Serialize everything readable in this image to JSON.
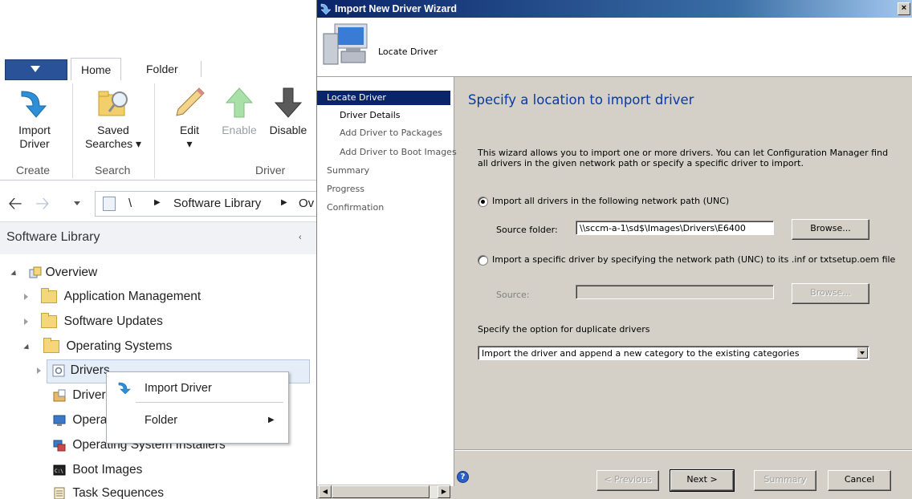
{
  "console": {
    "ribbon_tabs": [
      {
        "label": "Home"
      },
      {
        "label": "Folder"
      }
    ],
    "ribbon_buttons": {
      "import_driver": "Import\nDriver",
      "saved_searches": "Saved\nSearches ▾",
      "edit": "Edit\n▾",
      "enable": "Enable",
      "disable": "Disable"
    },
    "groups": {
      "create": "Create",
      "search": "Search",
      "driver": "Driver"
    },
    "address": {
      "sep": "\\",
      "crumb1": "Software Library",
      "crumb2": "Ov"
    },
    "panel_title": "Software Library",
    "tree": {
      "overview": "Overview",
      "application_management": "Application Management",
      "software_updates": "Software Updates",
      "operating_systems": "Operating Systems",
      "drivers": "Drivers",
      "driver_packages": "Driver",
      "os_images": "Opera",
      "os_installers": "Operating System Installers",
      "boot_images": "Boot Images",
      "task_sequences": "Task Sequences"
    },
    "context_menu": {
      "import_driver": "Import Driver",
      "folder": "Folder"
    }
  },
  "wizard": {
    "title": "Import New Driver Wizard",
    "header_title": "Locate Driver",
    "nav": [
      {
        "label": "Locate Driver"
      },
      {
        "label": "Driver Details"
      },
      {
        "label": "Add Driver to Packages"
      },
      {
        "label": "Add Driver to Boot Images"
      },
      {
        "label": "Summary"
      },
      {
        "label": "Progress"
      },
      {
        "label": "Confirmation"
      }
    ],
    "heading": "Specify a location to import driver",
    "description": "This wizard allows you to import one or more drivers. You can let Configuration Manager find all drivers in the given network path or specify a specific driver to import.",
    "option_all_label": "Import all drivers in the following network path (UNC)",
    "source_folder_label": "Source folder:",
    "source_folder_value": "\\\\sccm-a-1\\sd$\\Images\\Drivers\\E6400",
    "browse_label": "Browse...",
    "option_specific_label": "Import a specific driver by specifying the network path (UNC) to its .inf or txtsetup.oem file",
    "source_label": "Source:",
    "source_value": "",
    "browse2_label": "Browse...",
    "duplicate_label": "Specify the option for duplicate drivers",
    "duplicate_value": "Import the driver and append a new category to the existing categories",
    "buttons": {
      "previous": "< Previous",
      "next": "Next >",
      "summary": "Summary",
      "cancel": "Cancel"
    },
    "help_icon": "?"
  }
}
